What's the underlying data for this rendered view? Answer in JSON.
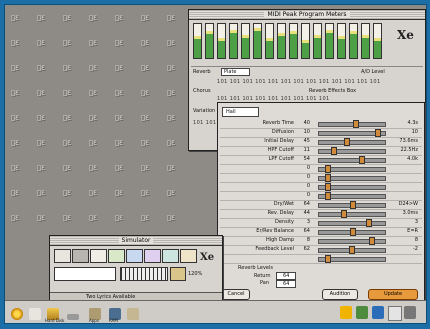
{
  "mixer_window": {
    "title": "MIDI Peak Program Meters",
    "reverb_label": "Reverb",
    "reverb_preset": "Plate",
    "ad_level_label": "A/D Level",
    "chorus_label": "Chorus",
    "variation_label": "Variation",
    "effects_title": "Reverb Effects Box",
    "meter_levels": [
      0.55,
      0.7,
      0.5,
      0.75,
      0.6,
      0.8,
      0.5,
      0.65,
      0.7,
      0.45,
      0.6,
      0.75,
      0.55,
      0.7,
      0.6,
      0.5
    ]
  },
  "reverb_dialog": {
    "preset": "Hall",
    "params": [
      {
        "label": "Reverb Time",
        "num": "40",
        "value": "4.3s",
        "level": 0.55
      },
      {
        "label": "Diffusion",
        "num": "10",
        "value": "10",
        "level": 0.9
      },
      {
        "label": "Initial Delay",
        "num": "45",
        "value": "73.6ms",
        "level": 0.4
      },
      {
        "label": "HPF Cutoff",
        "num": "11",
        "value": "22.5Hz",
        "level": 0.2
      },
      {
        "label": "LPF Cutoff",
        "num": "54",
        "value": "4.0k",
        "level": 0.65
      },
      {
        "label": "",
        "num": "0",
        "value": "",
        "level": 0.1
      },
      {
        "label": "",
        "num": "0",
        "value": "",
        "level": 0.1
      },
      {
        "label": "",
        "num": "0",
        "value": "",
        "level": 0.1
      },
      {
        "label": "",
        "num": "0",
        "value": "",
        "level": 0.1
      },
      {
        "label": "Dry/Wet",
        "num": "64",
        "value": "D24>W",
        "level": 0.5
      },
      {
        "label": "Rev. Delay",
        "num": "44",
        "value": "3.0ms",
        "level": 0.35
      },
      {
        "label": "Density",
        "num": "3",
        "value": "3",
        "level": 0.75
      },
      {
        "label": "Er/Rev Balance",
        "num": "64",
        "value": "E=R",
        "level": 0.5
      },
      {
        "label": "High Damp",
        "num": "8",
        "value": "8",
        "level": 0.8
      },
      {
        "label": "Feedback Level",
        "num": "62",
        "value": "-2",
        "level": 0.48
      },
      {
        "label": "",
        "num": "",
        "value": "",
        "level": 0.1
      }
    ],
    "levels_label": "Reverb Levels",
    "return_label": "Return",
    "return_value": "64",
    "pan_label": "Pan",
    "pan_value": "64",
    "cancel_label": "Cancel",
    "audition_label": "Audition",
    "update_label": "Update"
  },
  "launcher": {
    "title": "Simulator",
    "status": "Two Lyrics Available",
    "zoom": "120%"
  },
  "dock": {
    "items": [
      "",
      "Hard Disk",
      "",
      "Apps",
      "RAM"
    ]
  }
}
